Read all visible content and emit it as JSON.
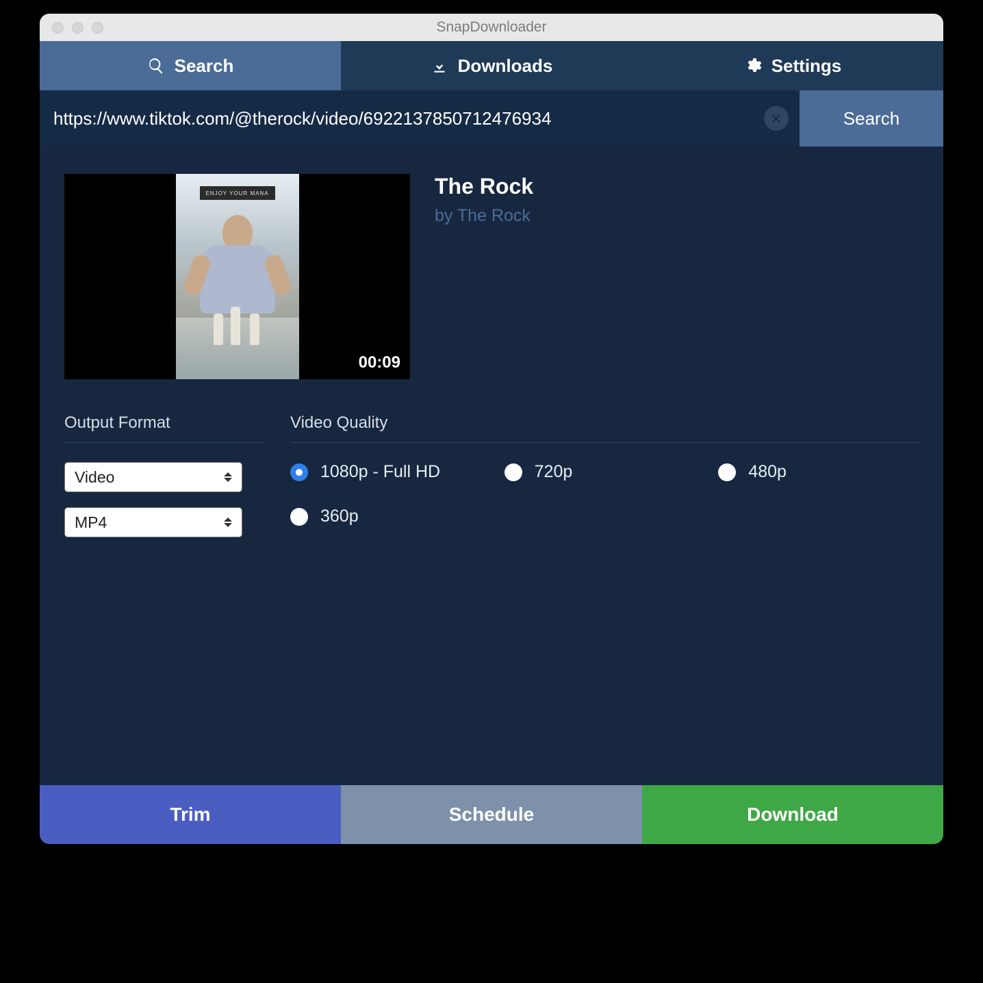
{
  "window": {
    "title": "SnapDownloader"
  },
  "tabs": {
    "search": "Search",
    "downloads": "Downloads",
    "settings": "Settings"
  },
  "search": {
    "url": "https://www.tiktok.com/@therock/video/6922137850712476934",
    "button": "Search"
  },
  "video": {
    "title": "The Rock",
    "author": "by The Rock",
    "duration": "00:09"
  },
  "format": {
    "section": "Output Format",
    "type": "Video",
    "container": "MP4"
  },
  "quality": {
    "section": "Video Quality",
    "options": {
      "q1080": "1080p - Full HD",
      "q720": "720p",
      "q480": "480p",
      "q360": "360p"
    },
    "selected": "q1080"
  },
  "footer": {
    "trim": "Trim",
    "schedule": "Schedule",
    "download": "Download"
  }
}
